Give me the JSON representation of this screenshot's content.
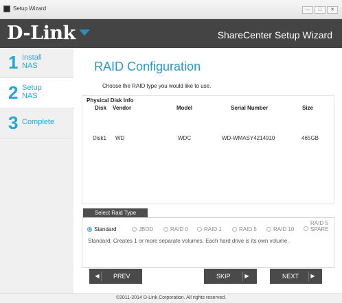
{
  "window": {
    "title": "Setup Wizard",
    "buttons": [
      "—",
      "□",
      "✕"
    ]
  },
  "header": {
    "brand": "D-Link",
    "wizard_title": "ShareCenter Setup Wizard"
  },
  "sidebar": {
    "steps": [
      {
        "num": "1",
        "line1": "Install",
        "line2": "NAS"
      },
      {
        "num": "2",
        "line1": "Setup",
        "line2": "NAS"
      },
      {
        "num": "3",
        "line1": "Complete",
        "line2": ""
      }
    ],
    "active_step": 2
  },
  "main": {
    "title": "RAID Configuration",
    "instruction": "Choose the RAID type you would like to use.",
    "disk_info": {
      "title": "Physical Disk Info",
      "columns": [
        "Disk",
        "Vendor",
        "Model",
        "Serial Number",
        "Size"
      ],
      "rows": [
        {
          "disk": "Disk1",
          "vendor": "WD",
          "model": "WDC",
          "serial": "WD-WMASY4214910",
          "size": "465GB"
        }
      ]
    },
    "raid_select": {
      "button": "Select Raid Type",
      "options": [
        "Standard",
        "JBOD",
        "RAID 0",
        "RAID 1",
        "RAID 5",
        "RAID 10"
      ],
      "spare_option": [
        "RAID 5",
        "SPARE"
      ],
      "selected": "Standard",
      "description": "Standard: Creates 1 or more separate volumes. Each hard drive is its own volume."
    }
  },
  "nav": {
    "prev": "PREV",
    "skip": "SKIP",
    "next": "NEXT"
  },
  "footer": {
    "copyright": "©2011-2014 D-Link Corporation. All rights reserved."
  },
  "colors": {
    "accent": "#24a6d9",
    "header_bg": "#444444",
    "button_bg": "#4a4a4a"
  }
}
